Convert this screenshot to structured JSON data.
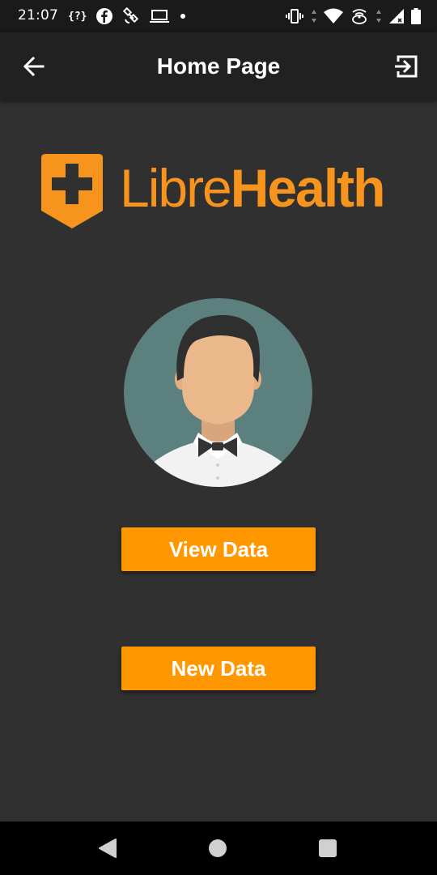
{
  "status_bar": {
    "time": "21:07",
    "braces_text": "{?}",
    "left_icons": [
      "braces-icon",
      "facebook-icon",
      "satellite-icon",
      "laptop-icon",
      "dot-icon"
    ],
    "right_icons": [
      "vibrate-icon",
      "data-arrows-icon",
      "wifi-icon",
      "hotspot-icon",
      "data-arrows-icon",
      "signal-icon",
      "battery-icon"
    ]
  },
  "app_bar": {
    "title": "Home Page",
    "back_icon": "arrow-left-icon",
    "logout_icon": "logout-icon"
  },
  "logo": {
    "text_light": "Libre",
    "text_bold": "Health",
    "icon": "plus-shield-icon",
    "color": "#f7941d"
  },
  "avatar": {
    "icon": "man-bowtie-avatar-icon",
    "background_color": "#5b807d"
  },
  "buttons": {
    "view_data": "View Data",
    "new_data": "New Data",
    "color": "#ff9800"
  },
  "nav_bar": {
    "icons": [
      "triangle-back-icon",
      "circle-home-icon",
      "square-recent-icon"
    ]
  }
}
